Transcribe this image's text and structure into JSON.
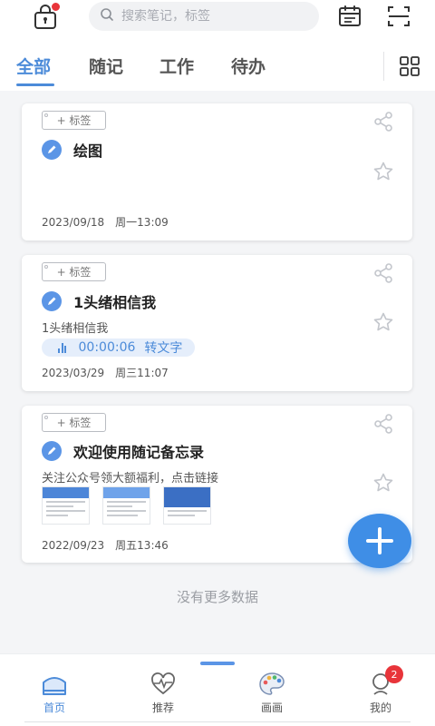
{
  "search": {
    "placeholder": "搜索笔记，标签"
  },
  "tabs": [
    {
      "label": "全部",
      "active": true
    },
    {
      "label": "随记",
      "active": false
    },
    {
      "label": "工作",
      "active": false
    },
    {
      "label": "待办",
      "active": false
    }
  ],
  "cards": [
    {
      "tag_label": "+ 标签",
      "title": "绘图",
      "subtitle": "",
      "date": "2023/09/18",
      "weekday_time": "周一13:09"
    },
    {
      "tag_label": "+ 标签",
      "title": "1头绪相信我",
      "subtitle": "1头绪相信我",
      "audio": {
        "duration": "00:00:06",
        "action": "转文字"
      },
      "date": "2023/03/29",
      "weekday_time": "周三11:07"
    },
    {
      "tag_label": "+ 标签",
      "title": "欢迎使用随记备忘录",
      "subtitle": "关注公众号领大额福利，点击链接",
      "thumbnails": 3,
      "date": "2022/09/23",
      "weekday_time": "周五13:46"
    }
  ],
  "list_footer": "没有更多数据",
  "bottom_nav": [
    {
      "label": "首页",
      "icon": "home-icon",
      "active": true
    },
    {
      "label": "推荐",
      "icon": "heart-pulse-icon",
      "active": false
    },
    {
      "label": "画画",
      "icon": "palette-icon",
      "active": false
    },
    {
      "label": "我的",
      "icon": "profile-icon",
      "active": false,
      "badge": "2"
    }
  ],
  "colors": {
    "accent": "#4c8bd9",
    "badge": "#e8343a",
    "fab": "#3f8ee6"
  }
}
